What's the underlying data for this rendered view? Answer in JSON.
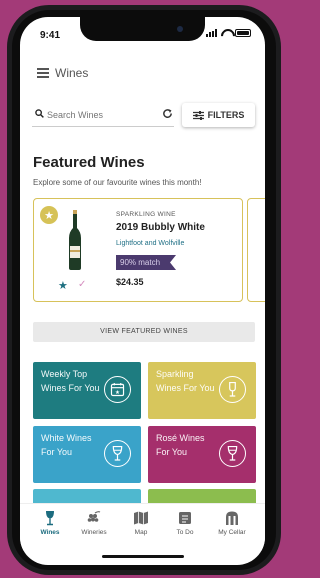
{
  "status": {
    "time": "9:41"
  },
  "appbar": {
    "title": "Wines"
  },
  "search": {
    "placeholder": "Search Wines"
  },
  "filters": {
    "label": "FILTERS"
  },
  "featured": {
    "title": "Featured Wines",
    "subtitle": "Explore some of our favourite wines this month!",
    "card": {
      "type": "SPARKLING WINE",
      "name": "2019 Bubbly White",
      "winery": "Lightfoot and Wolfville",
      "match": "90% match",
      "price": "$24.35"
    },
    "view_button": "VIEW FEATURED WINES"
  },
  "tiles": [
    {
      "label": "Weekly Top Wines For You",
      "color": "#1e7c80",
      "icon": "calendar-star-icon"
    },
    {
      "label": "Sparkling Wines For You",
      "color": "#d7c65c",
      "icon": "sparkling-glass-icon"
    },
    {
      "label": "White Wines For You",
      "color": "#3aa3c9",
      "icon": "white-wine-glass-icon"
    },
    {
      "label": "Rosé Wines For You",
      "color": "#a52f6c",
      "icon": "rose-wine-glass-icon"
    }
  ],
  "tabs": [
    {
      "label": "Wines",
      "icon": "wine-glass-icon",
      "active": true
    },
    {
      "label": "Wineries",
      "icon": "grapes-icon",
      "active": false
    },
    {
      "label": "Map",
      "icon": "map-icon",
      "active": false
    },
    {
      "label": "To Do",
      "icon": "todo-icon",
      "active": false
    },
    {
      "label": "My Cellar",
      "icon": "cellar-icon",
      "active": false
    }
  ],
  "colors": {
    "background": "#a33a78",
    "accent_teal": "#1c6c7f",
    "card_border": "#d7c25a",
    "match_badge": "#4b3a6e"
  }
}
